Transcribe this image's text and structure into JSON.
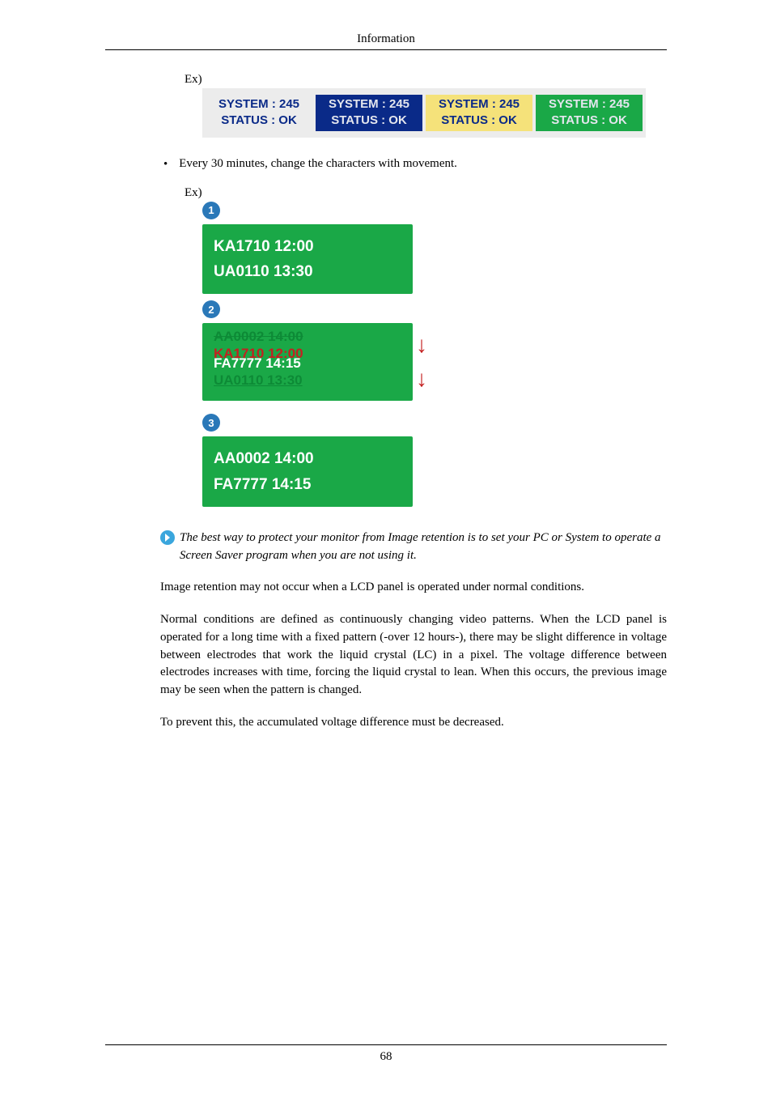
{
  "header": {
    "title": "Information"
  },
  "ex_label": "Ex)",
  "system_row": {
    "cells": [
      {
        "line1": "SYSTEM : 245",
        "line2": "STATUS : OK",
        "fg": "#0a2a88",
        "bg": "#ececec"
      },
      {
        "line1": "SYSTEM : 245",
        "line2": "STATUS : OK",
        "fg": "#e4e6ee",
        "bg": "#0a2a88"
      },
      {
        "line1": "SYSTEM : 245",
        "line2": "STATUS : OK",
        "fg": "#0a2a88",
        "bg": "#f5e27a"
      },
      {
        "line1": "SYSTEM : 245",
        "line2": "STATUS : OK",
        "fg": "#e4e6ee",
        "bg": "#1aa847"
      }
    ]
  },
  "bullet1": "Every 30 minutes, change the characters with movement.",
  "ex2": {
    "p1": {
      "badge": "1",
      "line1": "KA1710  12:00",
      "line2": "UA0110  13:30"
    },
    "p2": {
      "badge": "2",
      "ghost_top": "AA0002   14:00",
      "mid1": "KA1710  12:00",
      "mid2": "FA7777   14:15",
      "ghost_bot": "UA0110  13:30"
    },
    "p3": {
      "badge": "3",
      "line1": "AA0002  14:00",
      "line2": "FA7777  14:15"
    }
  },
  "note": " The best way to protect your monitor from Image retention is to set your PC or System to operate a Screen Saver program when you are not using it.",
  "para1": "Image retention may not occur when a LCD panel is operated under normal conditions.",
  "para2": "Normal conditions are defined as continuously changing video patterns. When the LCD panel is operated for a long time with a fixed pattern (-over 12 hours-), there may be slight difference in voltage between electrodes that work the liquid crystal (LC) in a pixel. The voltage difference between electrodes increases with time, forcing the liquid crystal to lean. When this occurs, the previous image may be seen when the pattern is changed.",
  "para3": "To prevent this, the accumulated voltage difference must be decreased.",
  "footer": {
    "page": "68"
  }
}
